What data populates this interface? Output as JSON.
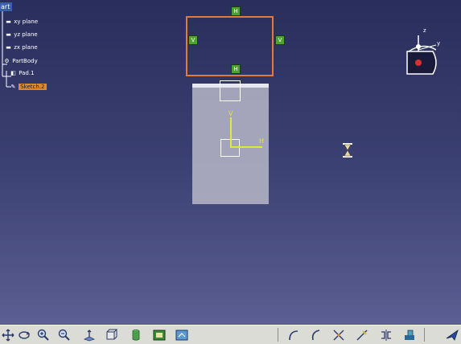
{
  "tree": {
    "root_label": "art",
    "items": [
      {
        "label": "xy plane",
        "icon": "plane-icon"
      },
      {
        "label": "yz plane",
        "icon": "plane-icon"
      },
      {
        "label": "zx plane",
        "icon": "plane-icon"
      },
      {
        "label": "PartBody",
        "icon": "partbody-icon"
      },
      {
        "label": "Pad.1",
        "icon": "pad-icon"
      },
      {
        "label": "Sketch.2",
        "icon": "sketch-icon",
        "selected": true
      }
    ]
  },
  "viewport": {
    "axis_v_label": "V",
    "axis_h_label": "H",
    "compass": {
      "z_label": "z",
      "y_label": "y"
    }
  },
  "colors": {
    "sketch_outline": "#e47a3a",
    "constraint": "#4ca32f",
    "axis": "#e2e83a",
    "selection": "#e08a2a"
  },
  "toolbar": {
    "left_icons": [
      "pan-icon",
      "rotate-icon",
      "zoom-in-icon",
      "zoom-out-icon",
      "normal-view-icon",
      "multi-view-icon",
      "shading-icon",
      "hide-show-icon",
      "swap-view-icon"
    ],
    "right_icons": [
      "arc-icon",
      "spline-icon",
      "trim-icon",
      "quick-trim-icon",
      "mirror-icon",
      "transform-icon",
      "exit-workbench-icon"
    ]
  }
}
